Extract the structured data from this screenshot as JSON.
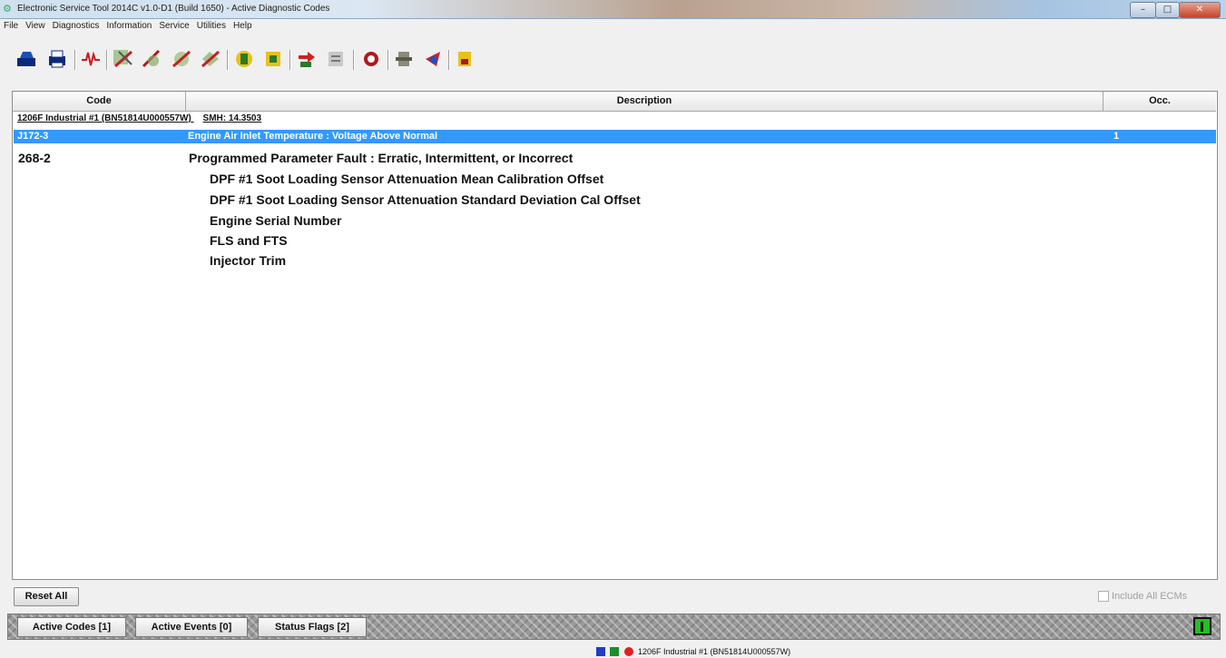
{
  "window": {
    "title": "Electronic Service Tool 2014C v1.0-D1 (Build 1650) - Active Diagnostic Codes",
    "minimize_glyph": "–",
    "maximize_glyph": "□",
    "close_glyph": "✕"
  },
  "menu": [
    "File",
    "View",
    "Diagnostics",
    "Information",
    "Service",
    "Utilities",
    "Help"
  ],
  "toolbar_icons": [
    "connect-ecm-icon",
    "print-icon",
    "graph-icon",
    "diagnostic-1-icon",
    "diagnostic-2-icon",
    "diagnostic-3-icon",
    "diagnostic-4-icon",
    "service-1-icon",
    "service-2-icon",
    "service-3-icon",
    "service-4-icon",
    "service-5-icon",
    "service-6-icon",
    "service-7-icon",
    "service-8-icon"
  ],
  "grid": {
    "headers": {
      "code": "Code",
      "description": "Description",
      "occ": "Occ."
    },
    "ecm": {
      "name": "1206F Industrial #1 (BN51814U000557W)",
      "smh": "SMH: 14.3503"
    },
    "selected_row": {
      "code": "J172-3",
      "description": "Engine Air Inlet Temperature : Voltage Above Normal",
      "occ": "1"
    },
    "row2": {
      "code": "268-2",
      "description": "Programmed Parameter Fault : Erratic, Intermittent, or Incorrect",
      "sub_items": [
        "DPF #1 Soot Loading Sensor Attenuation Mean Calibration Offset",
        "DPF #1 Soot Loading Sensor Attenuation Standard Deviation Cal Offset",
        "Engine Serial Number",
        "FLS and FTS",
        "Injector Trim"
      ]
    }
  },
  "controls": {
    "reset_all": "Reset All",
    "include_all_ecms": "Include All ECMs",
    "include_all_checked": false
  },
  "tabs": [
    "Active Codes [1]",
    "Active Events [0]",
    "Status Flags [2]"
  ],
  "status": {
    "text": "1206F Industrial #1 (BN51814U000557W)",
    "colors": {
      "blue": "#1f3fbf",
      "green": "#1a8f2a",
      "red": "#e02020"
    }
  }
}
